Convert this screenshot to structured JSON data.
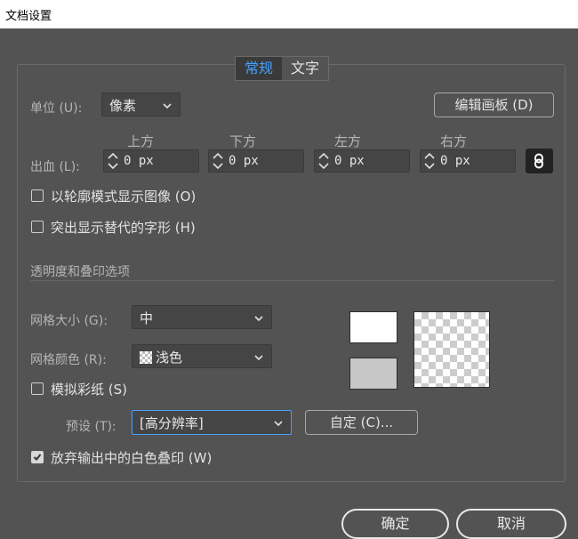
{
  "window": {
    "title": "文档设置"
  },
  "tabs": [
    {
      "label": "常规",
      "active": true
    },
    {
      "label": "文字",
      "active": false
    }
  ],
  "units": {
    "label": "单位 (U):",
    "value": "像素"
  },
  "edit_artboards_label": "编辑画板 (D)",
  "bleed": {
    "label": "出血 (L):",
    "fields": [
      {
        "caption": "上方",
        "value": "0 px"
      },
      {
        "caption": "下方",
        "value": "0 px"
      },
      {
        "caption": "左方",
        "value": "0 px"
      },
      {
        "caption": "右方",
        "value": "0 px"
      }
    ]
  },
  "options": {
    "outline_label": "以轮廓模式显示图像 (O)",
    "outline_checked": false,
    "highlight_label": "突出显示替代的字形 (H)",
    "highlight_checked": false
  },
  "transparency": {
    "section_title": "透明度和叠印选项",
    "grid_size_label": "网格大小 (G):",
    "grid_size_value": "中",
    "grid_color_label": "网格颜色 (R):",
    "grid_color_value": "浅色",
    "simulate_paper_label": "模拟彩纸 (S)",
    "simulate_paper_checked": false,
    "preset_label": "预设 (T):",
    "preset_value": "[高分辨率]",
    "custom_label": "自定 (C)...",
    "discard_label": "放弃输出中的白色叠印 (W)",
    "discard_checked": true
  },
  "footer": {
    "ok_label": "确定",
    "cancel_label": "取消"
  },
  "colors": {
    "accent": "#45a0ff",
    "background": "#535353"
  }
}
